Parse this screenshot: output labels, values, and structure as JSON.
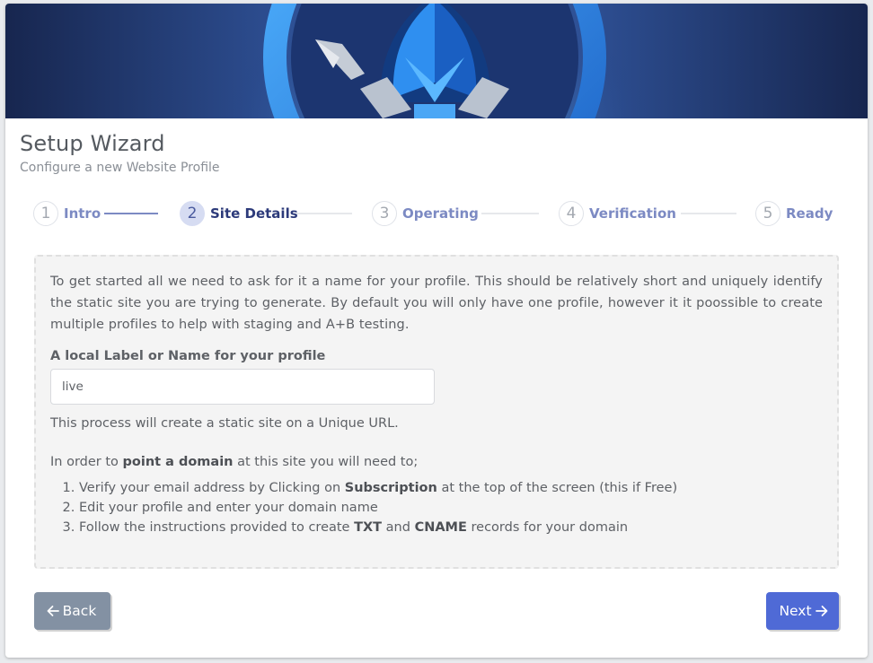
{
  "header": {
    "title": "Setup Wizard",
    "subtitle": "Configure a new Website Profile"
  },
  "stepper": {
    "current": 2,
    "steps": [
      {
        "number": "1",
        "label": "Intro"
      },
      {
        "number": "2",
        "label": "Site Details"
      },
      {
        "number": "3",
        "label": "Operating"
      },
      {
        "number": "4",
        "label": "Verification"
      },
      {
        "number": "5",
        "label": "Ready"
      }
    ]
  },
  "content": {
    "intro": "To get started all we need to ask for it a name for your profile. This should be relatively short and uniquely identify the static site you are trying to generate. By default you will only have one profile, however it it poossible to create multiple profiles to help with staging and A+B testing.",
    "field_label": "A local Label or Name for your profile",
    "field_value": "live",
    "process_text": "This process will create a static site on a Unique URL.",
    "domain_intro": {
      "before": "In order to ",
      "bold": "point a domain",
      "after": " at this site you will need to;"
    },
    "instructions": [
      {
        "before": "Verify your email address by Clicking on ",
        "bold": "Subscription",
        "after": " at the top of the screen (this if Free)"
      },
      {
        "text": "Edit your profile and enter your domain name"
      },
      {
        "before": "Follow the instructions provided to create ",
        "bold": "TXT",
        "middle": " and ",
        "bold2": "CNAME",
        "after": " records for your domain"
      }
    ]
  },
  "buttons": {
    "back_label": "Back",
    "next_label": "Next"
  },
  "colors": {
    "primary": "#4f6ad6",
    "secondary": "#8391a3",
    "step_active_text": "#2c3a7a",
    "step_text": "#7c8ac3"
  },
  "icons": {
    "back": "arrow-left-icon",
    "next": "arrow-right-icon"
  }
}
